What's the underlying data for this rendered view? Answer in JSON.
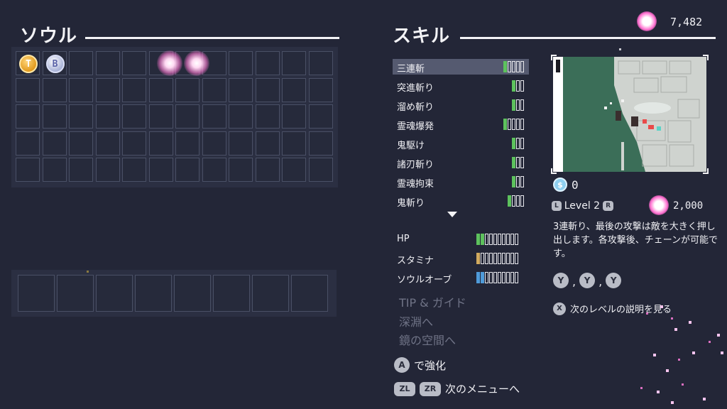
{
  "currency": {
    "soul_amount": "7,482"
  },
  "soul_section": {
    "title": "ソウル",
    "grid_rows": 5,
    "grid_cols": 12,
    "owned_souls": [
      {
        "letter": "T",
        "style": "gold"
      },
      {
        "letter": "B",
        "style": "silver"
      }
    ],
    "equip_slots": 8
  },
  "skill_section": {
    "title": "スキル",
    "skills": [
      {
        "name": "三連斬",
        "level": 1,
        "max": 5,
        "selected": true
      },
      {
        "name": "突進斬り",
        "level": 1,
        "max": 3
      },
      {
        "name": "溜め斬り",
        "level": 1,
        "max": 3
      },
      {
        "name": "霊魂爆発",
        "level": 1,
        "max": 5
      },
      {
        "name": "鬼駆け",
        "level": 1,
        "max": 3
      },
      {
        "name": "諸刃斬り",
        "level": 1,
        "max": 3
      },
      {
        "name": "霊魂拘束",
        "level": 1,
        "max": 3
      },
      {
        "name": "鬼斬り",
        "level": 1,
        "max": 4
      }
    ],
    "stats": [
      {
        "name": "HP",
        "level": 2,
        "max": 10,
        "color": "#5dc25d"
      },
      {
        "name": "スタミナ",
        "level": 1,
        "max": 10,
        "color": "#d1aa5f"
      },
      {
        "name": "ソウルオーブ",
        "level": 2,
        "max": 10,
        "color": "#4f9bd9"
      }
    ],
    "menu_links": [
      "TIP & ガイド",
      "深淵へ",
      "鏡の空間へ"
    ],
    "upgrade_hint": {
      "button": "A",
      "text": "で強化"
    },
    "next_menu_hint": {
      "buttons": [
        "ZL",
        "ZR"
      ],
      "text": "次のメニューへ"
    }
  },
  "detail": {
    "spirit_cost": "0",
    "level_label": "Level 2",
    "level_buttons": [
      "L",
      "R"
    ],
    "soul_cost": "2,000",
    "description": "3連斬り、最後の攻撃は敵を大きく押し出します。各攻撃後、チェーンが可能です。",
    "combo_buttons": [
      "Y",
      "Y",
      "Y"
    ],
    "combo_sep": ",",
    "next_level_hint": {
      "button": "X",
      "text": "次のレベルの説明を見る"
    }
  },
  "colors": {
    "background": "#232637",
    "pip_green": "#5dc25d",
    "pip_tan": "#d1aa5f",
    "pip_blue": "#4f9bd9",
    "soul_pink": "#ff6fd0"
  }
}
